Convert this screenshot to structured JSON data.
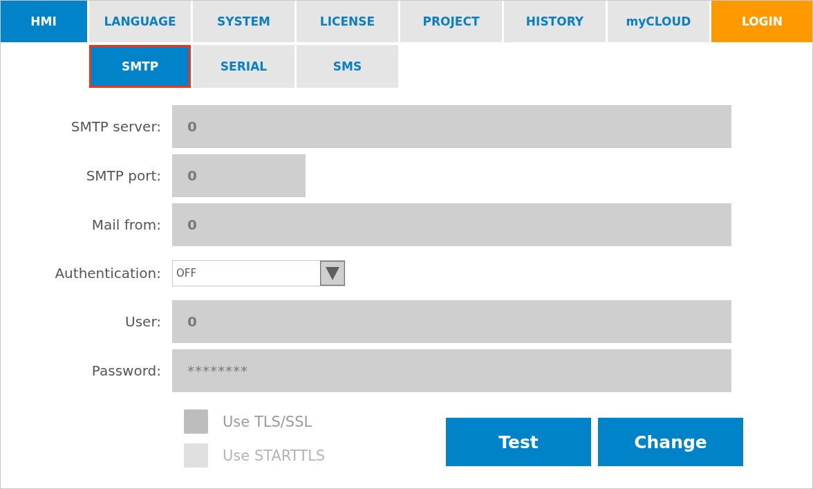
{
  "tabs": [
    {
      "label": "HMI",
      "selected": true,
      "kind": "nav"
    },
    {
      "label": "LANGUAGE",
      "selected": false,
      "kind": "nav"
    },
    {
      "label": "SYSTEM",
      "selected": false,
      "kind": "nav"
    },
    {
      "label": "LICENSE",
      "selected": false,
      "kind": "nav"
    },
    {
      "label": "PROJECT",
      "selected": false,
      "kind": "nav"
    },
    {
      "label": "HISTORY",
      "selected": false,
      "kind": "nav"
    },
    {
      "label": "myCLOUD",
      "selected": false,
      "kind": "nav"
    },
    {
      "label": "LOGIN",
      "selected": false,
      "kind": "login"
    }
  ],
  "subtabs": [
    {
      "label": "SMTP",
      "selected": true
    },
    {
      "label": "SERIAL",
      "selected": false
    },
    {
      "label": "SMS",
      "selected": false
    }
  ],
  "fields": [
    {
      "label": "SMTP server:",
      "kind": "text",
      "value": "0"
    },
    {
      "label": "SMTP port:",
      "kind": "number",
      "value": "0"
    },
    {
      "label": "Mail from:",
      "kind": "text",
      "value": "0"
    },
    {
      "label": "Authentication:",
      "kind": "select",
      "value": "OFF"
    },
    {
      "label": "User:",
      "kind": "text",
      "value": "0"
    },
    {
      "label": "Password:",
      "kind": "password",
      "value": "********"
    }
  ],
  "options": [
    {
      "label": "Use TLS/SSL",
      "checked": false,
      "disabled": false
    },
    {
      "label": "Use STARTTLS",
      "checked": false,
      "disabled": true
    }
  ],
  "buttons": [
    "Test",
    "Change"
  ]
}
